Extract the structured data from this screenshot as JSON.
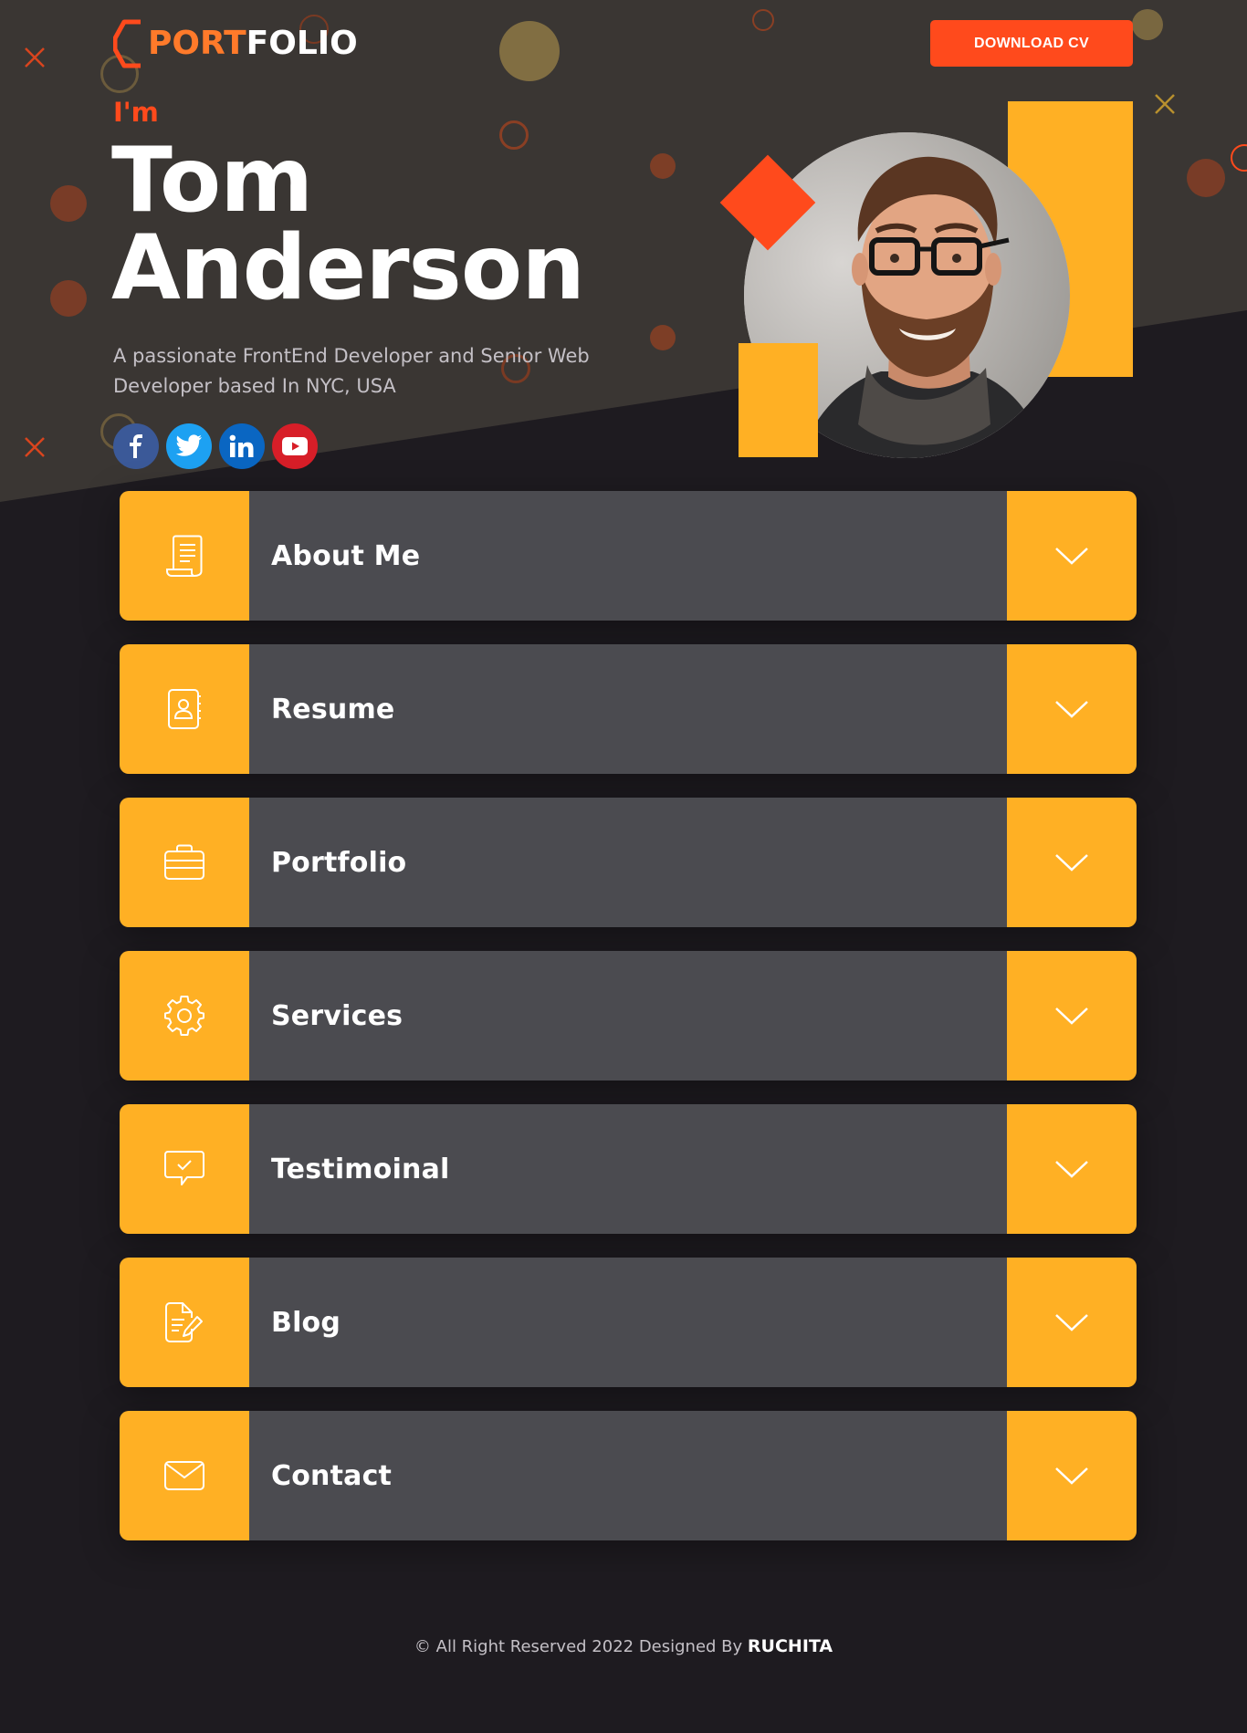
{
  "header": {
    "logo_accent": "PORT",
    "logo_rest": "FOLIO",
    "download_label": "DOWNLOAD CV"
  },
  "hero": {
    "intro": "I'm",
    "first_name": "Tom",
    "last_name": "Anderson",
    "tagline": "A passionate FrontEnd Developer and Senior Web Developer based In NYC, USA",
    "socials": [
      {
        "name": "facebook-icon",
        "color": "#3b5998"
      },
      {
        "name": "twitter-icon",
        "color": "#1da1f2"
      },
      {
        "name": "linkedin-icon",
        "color": "#0a66c2"
      },
      {
        "name": "youtube-icon",
        "color": "#d71e28"
      }
    ]
  },
  "sections": [
    {
      "label": "About Me",
      "icon": "document-icon"
    },
    {
      "label": "Resume",
      "icon": "contact-book-icon"
    },
    {
      "label": "Portfolio",
      "icon": "briefcase-icon"
    },
    {
      "label": "Services",
      "icon": "gear-icon"
    },
    {
      "label": "Testimoinal",
      "icon": "chat-check-icon"
    },
    {
      "label": "Blog",
      "icon": "edit-document-icon"
    },
    {
      "label": "Contact",
      "icon": "envelope-icon"
    }
  ],
  "footer": {
    "text": "© All Right Reserved 2022 Designed By",
    "author": "RUCHITA"
  },
  "colors": {
    "accent_orange": "#ff4a1c",
    "accent_yellow": "#ffb024",
    "hero_bg": "#3a3633",
    "page_bg": "#1e1b20",
    "card_bg": "#4b4b50"
  }
}
